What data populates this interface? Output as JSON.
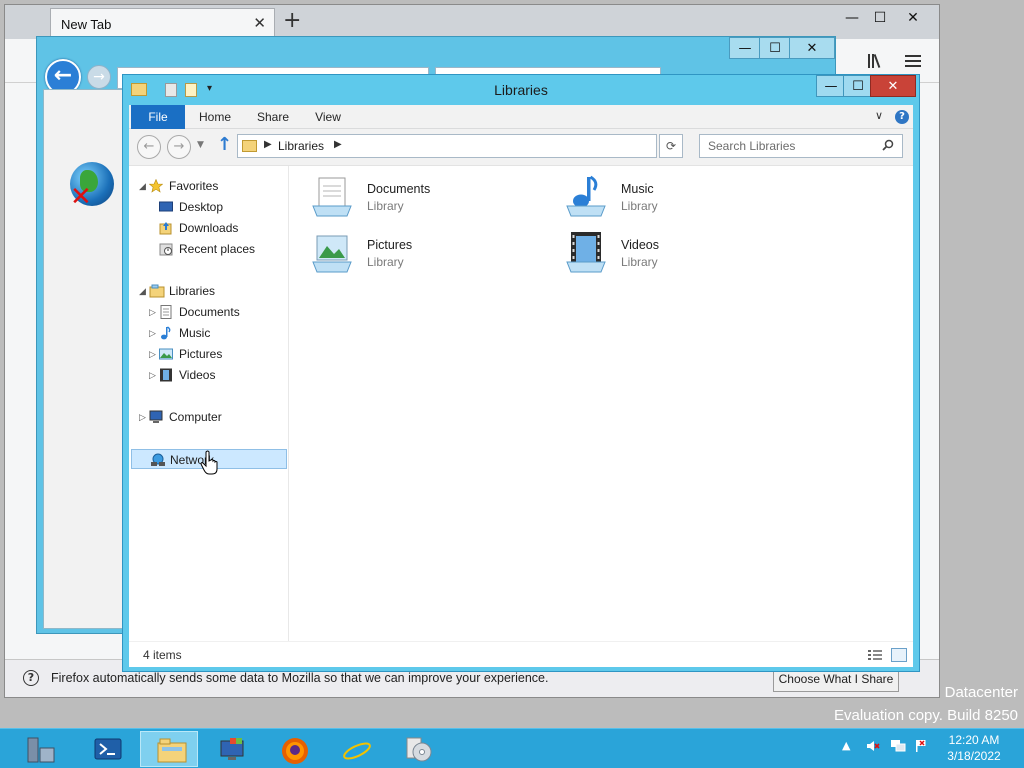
{
  "desktop": {
    "watermark_edition": "Datacenter",
    "watermark_build": "Evaluation copy. Build 8250"
  },
  "firefox": {
    "tab_title": "New Tab",
    "tab_close": "✕",
    "new_tab": "+",
    "win_min": "—",
    "win_max": "☐",
    "win_close": "✕",
    "library_icon": "library-icon",
    "menu_icon": "hamburger-menu-icon",
    "notification_text": "Firefox automatically sends some data to Mozilla so that we can improve your experience.",
    "notification_button": "Choose What I Share"
  },
  "ie": {
    "win_min": "—",
    "win_max": "☐",
    "win_close": "✕"
  },
  "explorer": {
    "title": "Libraries",
    "win_min": "—",
    "win_max": "☐",
    "win_close": "✕",
    "ribbon": {
      "file": "File",
      "home": "Home",
      "share": "Share",
      "view": "View"
    },
    "address": {
      "crumb": "Libraries"
    },
    "search_placeholder": "Search Libraries",
    "nav": {
      "favorites": "Favorites",
      "desktop": "Desktop",
      "downloads": "Downloads",
      "recent": "Recent places",
      "libraries": "Libraries",
      "documents": "Documents",
      "music": "Music",
      "pictures": "Pictures",
      "videos": "Videos",
      "computer": "Computer",
      "network": "Network"
    },
    "items": [
      {
        "name": "Documents",
        "type": "Library"
      },
      {
        "name": "Music",
        "type": "Library"
      },
      {
        "name": "Pictures",
        "type": "Library"
      },
      {
        "name": "Videos",
        "type": "Library"
      }
    ],
    "status": "4 items"
  },
  "taskbar": {
    "time": "12:20 AM",
    "date": "3/18/2022"
  },
  "colors": {
    "explorer_frame": "#5ec9eb",
    "ribbon_file": "#1a6fc4",
    "taskbar": "#2aa4d9",
    "close_button": "#c94338"
  }
}
